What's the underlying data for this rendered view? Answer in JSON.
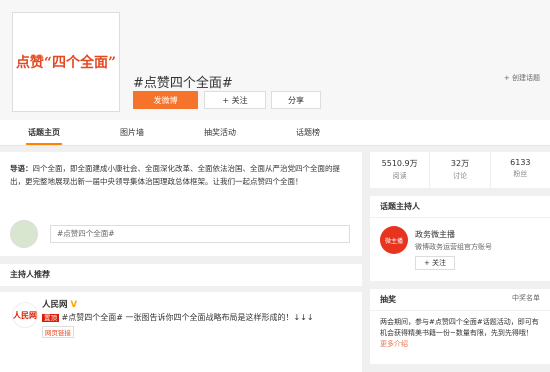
{
  "banner": {
    "logo_text": "点赞“四个全面”",
    "topic_title": "#点赞四个全面#",
    "post_button": "发微博",
    "follow_button": "+ 关注",
    "share_button": "分享",
    "create_topic": "+ 创建话题"
  },
  "tabs": [
    "话题主页",
    "图片墙",
    "抽奖活动",
    "话题榜"
  ],
  "intro": {
    "label": "导语：",
    "text": "四个全面，即全面建成小康社会、全面深化改革、全面依法治国、全面从严治党四个全面的提出，更完整地展现出新一届中央领导集体治国理政总体框架。让我们一起点赞四个全面！"
  },
  "post_input": {
    "placeholder": "#点赞四个全面#"
  },
  "host_section": {
    "label": "主持人推荐"
  },
  "feed": {
    "logo": "人民网",
    "name": "人民网",
    "verify": "V",
    "tag": "置顶",
    "text": "#点赞四个全面# 一张图告诉你四个全面战略布局是这样形成的！↓↓↓",
    "link": "网页链接"
  },
  "stats": [
    {
      "value": "5510.9万",
      "label": "阅读"
    },
    {
      "value": "32万",
      "label": "讨论"
    },
    {
      "value": "6133",
      "label": "粉丝"
    }
  ],
  "host_card": {
    "title": "话题主持人",
    "avatar": "微主播",
    "name": "政务微主播",
    "desc": "微博政务运营组官方账号",
    "follow": "+ 关注"
  },
  "prize": {
    "title": "抽奖",
    "link": "中奖名单",
    "text": "两会期间，参与#点赞四个全面#话题活动，即可有机会获得精美书籍一份~数量有限，先到先得哦！",
    "more": "更多介绍"
  }
}
